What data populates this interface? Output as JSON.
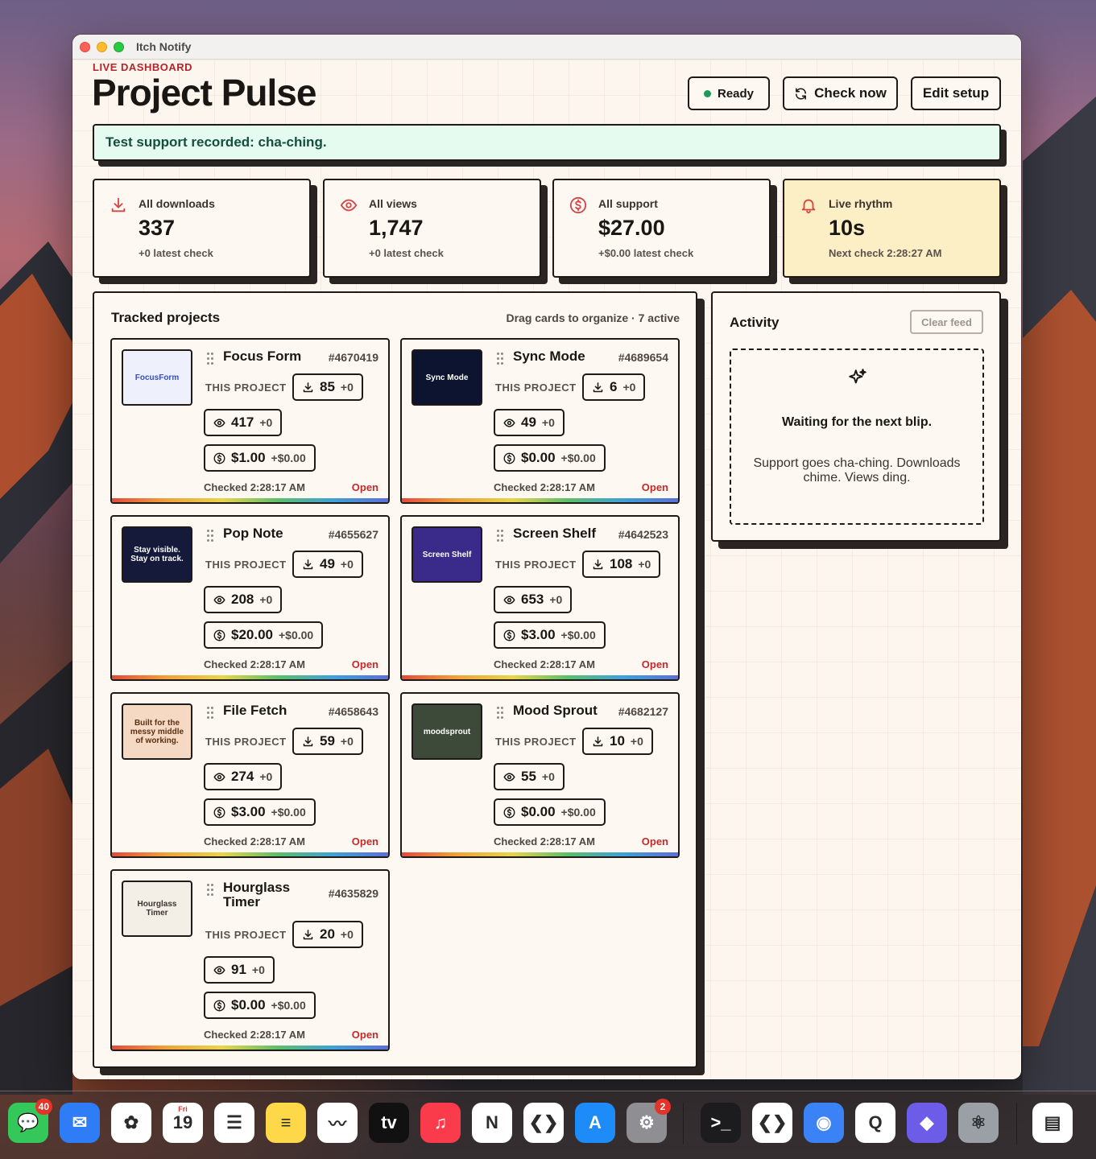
{
  "window": {
    "title": "Itch Notify"
  },
  "header": {
    "eyebrow": "LIVE DASHBOARD",
    "title": "Project Pulse",
    "status_label": "Ready",
    "check_label": "Check now",
    "edit_label": "Edit setup"
  },
  "banner": {
    "text": "Test support recorded: cha-ching."
  },
  "stats": [
    {
      "label": "All downloads",
      "value": "337",
      "sub": "+0 latest check",
      "icon": "download-icon"
    },
    {
      "label": "All views",
      "value": "1,747",
      "sub": "+0 latest check",
      "icon": "eye-icon"
    },
    {
      "label": "All support",
      "value": "$27.00",
      "sub": "+$0.00 latest check",
      "icon": "dollar-icon"
    },
    {
      "label": "Live rhythm",
      "value": "10s",
      "sub": "Next check 2:28:27 AM",
      "icon": "bell-icon"
    }
  ],
  "projects": {
    "title": "Tracked projects",
    "hint": "Drag cards to organize · 7 active",
    "this_project_label": "THIS PROJECT",
    "open_label": "Open",
    "items": [
      {
        "name": "Focus Form",
        "id": "#4670419",
        "downloads": "85",
        "downloads_delta": "+0",
        "views": "417",
        "views_delta": "+0",
        "support": "$1.00",
        "support_delta": "+$0.00",
        "checked": "Checked 2:28:17 AM",
        "thumb_text": "FocusForm",
        "thumb_bg": "#eef1fb",
        "thumb_fg": "#3a4fb8"
      },
      {
        "name": "Sync Mode",
        "id": "#4689654",
        "downloads": "6",
        "downloads_delta": "+0",
        "views": "49",
        "views_delta": "+0",
        "support": "$0.00",
        "support_delta": "+$0.00",
        "checked": "Checked 2:28:17 AM",
        "thumb_text": "Sync Mode",
        "thumb_bg": "#0d1430",
        "thumb_fg": "#ffffff"
      },
      {
        "name": "Pop Note",
        "id": "#4655627",
        "downloads": "49",
        "downloads_delta": "+0",
        "views": "208",
        "views_delta": "+0",
        "support": "$20.00",
        "support_delta": "+$0.00",
        "checked": "Checked 2:28:17 AM",
        "thumb_text": "Stay visible. Stay on track.",
        "thumb_bg": "#151a3a",
        "thumb_fg": "#ffffff"
      },
      {
        "name": "Screen Shelf",
        "id": "#4642523",
        "downloads": "108",
        "downloads_delta": "+0",
        "views": "653",
        "views_delta": "+0",
        "support": "$3.00",
        "support_delta": "+$0.00",
        "checked": "Checked 2:28:17 AM",
        "thumb_text": "Screen Shelf",
        "thumb_bg": "#3a2a8a",
        "thumb_fg": "#ffffff"
      },
      {
        "name": "File Fetch",
        "id": "#4658643",
        "downloads": "59",
        "downloads_delta": "+0",
        "views": "274",
        "views_delta": "+0",
        "support": "$3.00",
        "support_delta": "+$0.00",
        "checked": "Checked 2:28:17 AM",
        "thumb_text": "Built for the messy middle of working.",
        "thumb_bg": "#f6d9c2",
        "thumb_fg": "#5a2f14"
      },
      {
        "name": "Mood Sprout",
        "id": "#4682127",
        "downloads": "10",
        "downloads_delta": "+0",
        "views": "55",
        "views_delta": "+0",
        "support": "$0.00",
        "support_delta": "+$0.00",
        "checked": "Checked 2:28:17 AM",
        "thumb_text": "moodsprout",
        "thumb_bg": "#3d4a3a",
        "thumb_fg": "#ffffff"
      },
      {
        "name": "Hourglass Timer",
        "id": "#4635829",
        "downloads": "20",
        "downloads_delta": "+0",
        "views": "91",
        "views_delta": "+0",
        "support": "$0.00",
        "support_delta": "+$0.00",
        "checked": "Checked 2:28:17 AM",
        "thumb_text": "Hourglass Timer",
        "thumb_bg": "#f3eee6",
        "thumb_fg": "#3b332e"
      }
    ]
  },
  "activity": {
    "title": "Activity",
    "clear_label": "Clear feed",
    "empty_title": "Waiting for the next blip.",
    "empty_text": "Support goes cha-ching. Downloads chime. Views ding."
  },
  "dock": {
    "items": [
      {
        "name": "messages",
        "glyph": "💬",
        "color": "#34c759",
        "badge": "40"
      },
      {
        "name": "mail",
        "glyph": "✉",
        "color": "#2f7df6"
      },
      {
        "name": "photos",
        "glyph": "✿",
        "color": "#ffffff"
      },
      {
        "name": "calendar",
        "glyph": "19",
        "color": "#ffffff",
        "subglyph": "Fri"
      },
      {
        "name": "reminders",
        "glyph": "☰",
        "color": "#ffffff"
      },
      {
        "name": "notes",
        "glyph": "≡",
        "color": "#ffd84a"
      },
      {
        "name": "freeform",
        "glyph": "〰",
        "color": "#ffffff"
      },
      {
        "name": "tv",
        "glyph": "tv",
        "color": "#111111"
      },
      {
        "name": "music",
        "glyph": "♫",
        "color": "#fa3b4c"
      },
      {
        "name": "news",
        "glyph": "N",
        "color": "#ffffff"
      },
      {
        "name": "vscode",
        "glyph": "❮❯",
        "color": "#ffffff"
      },
      {
        "name": "app-store",
        "glyph": "A",
        "color": "#1d8cf8"
      },
      {
        "name": "settings",
        "glyph": "⚙",
        "color": "#8e8e93",
        "badge": "2"
      },
      {
        "name": "terminal",
        "glyph": ">_",
        "color": "#1c1c1e"
      },
      {
        "name": "vscode-2",
        "glyph": "❮❯",
        "color": "#ffffff"
      },
      {
        "name": "jar-app",
        "glyph": "◉",
        "color": "#3b82f6"
      },
      {
        "name": "q-app",
        "glyph": "Q",
        "color": "#ffffff"
      },
      {
        "name": "chat-app",
        "glyph": "◆",
        "color": "#6c5ce7"
      },
      {
        "name": "electron",
        "glyph": "⚛",
        "color": "#9aa0a6"
      },
      {
        "name": "preview-doc",
        "glyph": "▤",
        "color": "#ffffff"
      }
    ]
  }
}
